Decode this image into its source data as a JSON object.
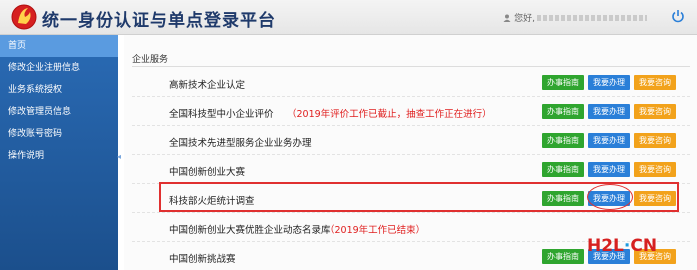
{
  "header": {
    "title": "统一身份认证与单点登录平台",
    "user_greeting": "您好,"
  },
  "sidebar": {
    "items": [
      {
        "label": "首页"
      },
      {
        "label": "修改企业注册信息"
      },
      {
        "label": "业务系统授权"
      },
      {
        "label": "修改管理员信息"
      },
      {
        "label": "修改账号密码"
      },
      {
        "label": "操作说明"
      }
    ]
  },
  "main": {
    "section_title": "企业服务",
    "buttons": {
      "guide": "办事指南",
      "apply": "我要办理",
      "consult": "我要咨询"
    },
    "services": [
      {
        "name": "高新技术企业认定",
        "note": ""
      },
      {
        "name": "全国科技型中小企业评价",
        "note": "（2019年评价工作已截止，抽查工作正在进行）"
      },
      {
        "name": "全国技术先进型服务企业业务办理",
        "note": ""
      },
      {
        "name": "中国创新创业大赛",
        "note": ""
      },
      {
        "name": "科技部火炬统计调查",
        "note": ""
      },
      {
        "name": "中国创新创业大赛优胜企业动态名录库",
        "note": "（2019年工作已结束）"
      },
      {
        "name": "中国创新挑战赛",
        "note": ""
      }
    ]
  },
  "watermark": {
    "text_a": "H2L",
    "text_dot": "·",
    "text_b": "CN"
  }
}
